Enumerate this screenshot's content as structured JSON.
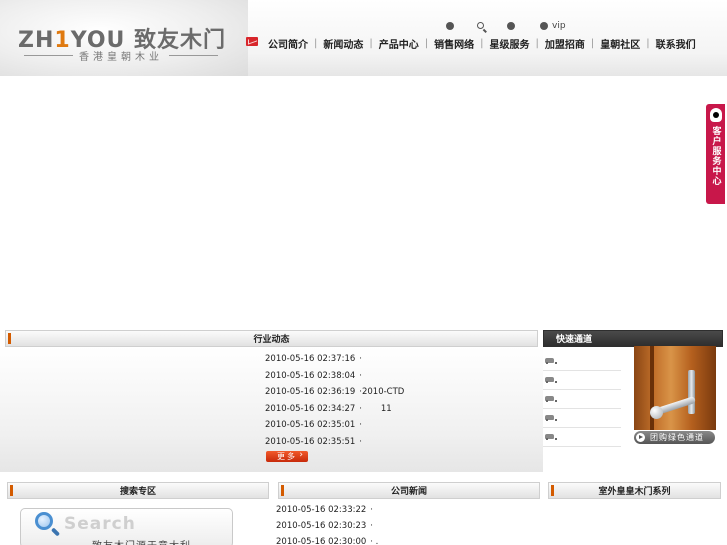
{
  "header": {
    "logo_main_a": "ZH",
    "logo_main_accent": "1",
    "logo_main_b": "YOU 致友木门",
    "logo_sub": "香港皇朝木业"
  },
  "nav": {
    "items": [
      "公司简介",
      "新闻动态",
      "产品中心",
      "销售网络",
      "星级服务",
      "加盟招商",
      "皇朝社区",
      "联系我们"
    ],
    "separator": "|",
    "vip_label": "vip"
  },
  "service_tab": {
    "label": "客户服务中心"
  },
  "industry_news": {
    "title": "行业动态",
    "rows": [
      {
        "date": "2010-05-16 02:37:16",
        "title": "·"
      },
      {
        "date": "2010-05-16 02:38:04",
        "title": "·"
      },
      {
        "date": "2010-05-16 02:36:19",
        "title": "·2010-CTD"
      },
      {
        "date": "2010-05-16 02:34:27",
        "title": "·       11"
      },
      {
        "date": "2010-05-16 02:35:01",
        "title": "·"
      },
      {
        "date": "2010-05-16 02:35:51",
        "title": "·"
      }
    ],
    "more_label": "更多"
  },
  "quick_links": {
    "title": "快速通道",
    "group_buy_label": "团购绿色通道"
  },
  "search_section": {
    "title": "搜索专区",
    "search_word": "Search",
    "sub_text": "致友木门源于意大利"
  },
  "company_news": {
    "title": "公司新闻",
    "rows": [
      {
        "date": "2010-05-16 02:33:22",
        "title": "·"
      },
      {
        "date": "2010-05-16 02:30:23",
        "title": "·"
      },
      {
        "date": "2010-05-16 02:30:00",
        "title": "· ."
      }
    ]
  },
  "series_section": {
    "title": "室外皇皇木门系列"
  }
}
